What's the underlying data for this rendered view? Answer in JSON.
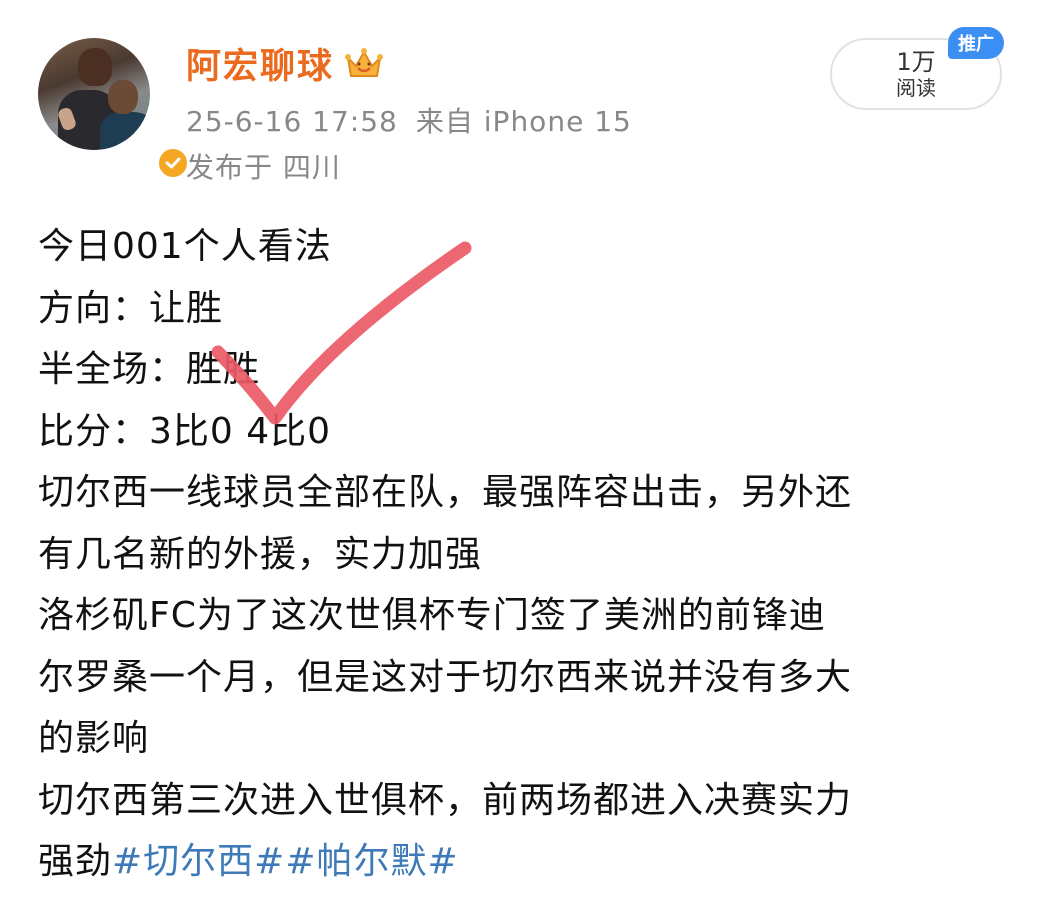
{
  "user": {
    "name": "阿宏聊球",
    "time": "25-6-16 17:58",
    "source": "来自 iPhone 15",
    "location": "发布于 四川"
  },
  "stats": {
    "reads_count": "1万",
    "reads_label": "阅读",
    "ad_badge": "推广"
  },
  "post": {
    "lines": [
      "今日001个人看法",
      "方向：让胜",
      "半全场：胜胜",
      "比分：3比0 4比0",
      "切尔西一线球员全部在队，最强阵容出击，另外还",
      "有几名新的外援，实力加强",
      "洛杉矶FC为了这次世俱杯专门签了美洲的前锋迪",
      "尔罗桑一个月，但是这对于切尔西来说并没有多大",
      "的影响",
      "切尔西第三次进入世俱杯，前两场都进入决赛实力"
    ],
    "last_line_text": "强劲",
    "hashtags": [
      "#切尔西#",
      "#帕尔默#"
    ]
  },
  "colors": {
    "name": "#ec6a1d",
    "hashtag": "#3e7ab8",
    "check": "#ec5a66",
    "ad": "#3b8ff2"
  },
  "icons": {
    "verified": "verified-badge-icon",
    "crown": "crown-icon",
    "check": "checkmark-icon"
  }
}
